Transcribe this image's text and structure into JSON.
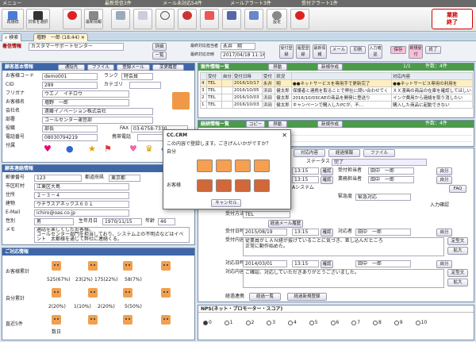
{
  "menubar": {
    "menu": "メニュー",
    "news": "最新受信3件",
    "mail": "メール未対応54件",
    "alert": "メールアラート3件",
    "reception": "受付アラート1件"
  },
  "toolbar": {
    "items": [
      "再接続",
      "対象を選択",
      "",
      "最新情報",
      "",
      "",
      "",
      "",
      "",
      "",
      "",
      "設定"
    ],
    "exit_line1": "業務",
    "exit_line2": "終了"
  },
  "tabs": {
    "search": "検索",
    "customer": "増野　一郎",
    "time": "(18:44)"
  },
  "header": {
    "company_label": "着信情報",
    "company_value": "カスタマーサポートセンター",
    "detail": "詳細",
    "list": "一覧",
    "last_rep_label": "最終対応担当者",
    "last_rep_value": "永井　翔",
    "last_date_label": "最終対応日時",
    "last_date_value": "2017/04/18 11:16",
    "buttons": [
      "受付登録",
      "履歴登録",
      "最新情報",
      "メール",
      "印刷",
      "入力確認",
      "保存",
      "新規受付",
      "終了"
    ]
  },
  "basic": {
    "title": "顧客基本情報",
    "tools": [
      "通話先",
      "ファイル",
      "登録メール",
      "変更履歴"
    ],
    "code_label": "お客様コード",
    "code": "demo001",
    "rank_label": "ランク",
    "rank": "特会員",
    "cid_label": "CID",
    "cid": "289",
    "cat_label": "カテゴリ",
    "kana_label": "フリガナ",
    "kana": "ウエノ　イチロウ",
    "name_label": "お客様名",
    "name": "増野　一郎",
    "company_label": "会社名",
    "company": "遠藤イノベーション株式会社",
    "dept_label": "部署",
    "dept": "コールセンター運営部",
    "title_label": "役職",
    "title_value": "部長",
    "fax_label": "FAX",
    "fax": "03-6758-7330",
    "tel_label": "電話番号",
    "tel": "08030794219",
    "mobile_label": "携帯電話",
    "attach_label": "付属"
  },
  "address": {
    "title": "顧客連絡情報",
    "zip_label": "郵便番号",
    "zip": "123",
    "pref_label": "都道府県",
    "pref": "東京都",
    "city_label": "市区町村",
    "city": "江東区大島",
    "addr_label": "住所",
    "addr": "２－３－４",
    "bldg_label": "建物",
    "bldg": "ウチラスアネックス６０１",
    "email_label": "E-Mail",
    "email": "ichiro@oas.co.jp",
    "sex_label": "性別",
    "sex": "男",
    "birth_label": "生年月日",
    "birth": "1970/11/15",
    "age_label": "年齢",
    "age": "46",
    "memo_label": "メモ",
    "memo": "通話を楽しくしたお客様。\nコールセンター部門を担当しており、システム上の不明点などはイベント　太都様を通じて弊社に連絡くる。"
  },
  "stats": {
    "title": "ご対応情報",
    "rows": [
      {
        "label": "お客様累計",
        "items": [
          "525(67%)",
          "23(2%)",
          "175(22%)",
          "58(7%)"
        ]
      },
      {
        "label": "自分累計",
        "items": [
          "2(20%)",
          "1(10%)",
          "2(20%)",
          "5(50%)"
        ]
      },
      {
        "label": "直近5件",
        "items": [
          "",
          "",
          "",
          ""
        ]
      }
    ],
    "footer": "数日"
  },
  "cases": {
    "title": "案件情報一覧",
    "move": "移動",
    "new": "新規作成",
    "page": "1/1",
    "count": "件数：4件",
    "cols": [
      "",
      "受付",
      "自分",
      "受付日時",
      "受付",
      "状況",
      "",
      "対応内容"
    ],
    "rows": [
      [
        "4",
        "TEL",
        "",
        "2016/10/17",
        "永井",
        "翔",
        "●●ネットサービスを専用手で更新完了"
      ],
      [
        "3",
        "TEL",
        "",
        "2016/10/05",
        "浜田",
        "健太郎",
        "保護者と連携を取ることで弊社に問い合わせてく"
      ],
      [
        "2",
        "TEL",
        "",
        "2016/10/03",
        "浜田",
        "健太郎",
        "2016/10/03CAEの商品を開発に登送り"
      ],
      [
        "1",
        "TEL",
        "",
        "2016/10/03",
        "浜田",
        "健太郎",
        "キャンペーンで購入したPCが、不…"
      ]
    ],
    "col_right": "対応内容",
    "right_lines": [
      "●●ネットサービス専用の利用を",
      "ＸＸ漫画の商品の在庫を確認してほしい",
      "インク費用から連絡を取り消したい",
      "購入した商品に起動できない"
    ]
  },
  "history": {
    "title": "経続情報一覧",
    "copy": "コピー",
    "move": "移動",
    "new": "新規作成",
    "count": "件数：4件"
  },
  "detail": {
    "tabs": [
      "対応内容",
      "経過情報",
      "ファイル"
    ],
    "status_label": "ステータス",
    "status": "完了",
    "date1": "2015/08/19",
    "time1": "13:15",
    "rec_rep_label": "受付担当者",
    "rec_rep": "田中　一郎",
    "date2": "2015/08/19",
    "time2": "13:15",
    "done_rep_label": "業務担当者",
    "done_rep": "田中　一郎",
    "sys_label": "Aシステム",
    "faq": "FAQ",
    "urgent_label": "緊急度",
    "urgent": "緊急対応",
    "ch_label": "受付方法",
    "ch": "TEL",
    "prog": "経過メール履歴",
    "r_date_label": "受付日時",
    "r_date": "2015/08/19",
    "r_time": "13:15",
    "r_rep_label": "対応者",
    "r_rep": "田中　一郎",
    "r_content_label": "受付内容",
    "r_content": "従業員がＬＡＮ経が抜けていることに気づき、差し込んだところ\n正常に動作始めた。",
    "o_date_label": "対応日時",
    "o_date": "2014/03/01",
    "o_time": "13:15",
    "o_rep": "田中　一郎",
    "o_content_label": "対応内容",
    "o_content": "ご確認、対応していただきありがとうございました。",
    "reg_label": "経過連携",
    "reg_list": "経過一覧",
    "reg_new": "経過新規登録",
    "fixed": "定型文",
    "enlarge": "拡大",
    "check": "確認",
    "self": "自分",
    "entry_conf": "入力確認"
  },
  "nps": {
    "title": "NPS(ネット・プロモーター・スコア)",
    "scale": [
      "0",
      "1",
      "2",
      "3",
      "4",
      "5",
      "6",
      "7",
      "8",
      "9",
      "10"
    ]
  },
  "modal": {
    "title": "CC.CRM",
    "question": "この内容で登録します。ごきげんいかがですか？",
    "self_label": "自分",
    "cust_label": "お客様",
    "cancel": "キャンセル"
  }
}
